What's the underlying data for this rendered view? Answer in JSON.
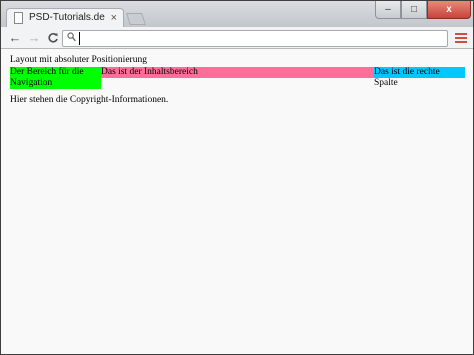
{
  "browser": {
    "tab_title": "PSD-Tutorials.de",
    "tab_close": "×",
    "nav_back": "←",
    "nav_forward": "→",
    "nav_reload": "C",
    "address_value": "",
    "window_min": "–",
    "window_max": "□",
    "window_close": "x"
  },
  "page": {
    "heading": "Layout mit absoluter Positionierung",
    "nav_text": "Der Bereich für die Navigation",
    "content_text": "Das ist der Inhaltsbereich",
    "right_text": "Das ist die rechte Spalte",
    "footer_text": "Hier stehen die Copyright-Informationen."
  },
  "colors": {
    "navigation": "#00ff00",
    "content": "#ff6e9a",
    "right_column": "#00c8ff",
    "page_background": "#f9f9f9"
  }
}
